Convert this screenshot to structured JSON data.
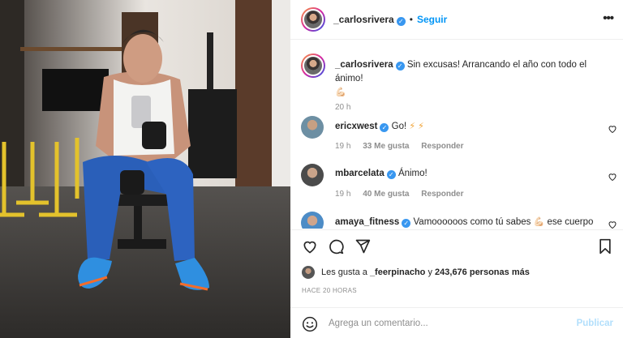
{
  "post": {
    "username": "_carlosrivera",
    "follow_label": "Seguir",
    "separator": "•"
  },
  "caption": {
    "username": "_carlosrivera",
    "text": "Sin excusas! Arrancando el año con todo el ánimo!",
    "emoji": "💪🏻",
    "time": "20 h"
  },
  "comments": [
    {
      "username": "ericxwest",
      "text": "Go!",
      "emoji": "⚡ ⚡",
      "time": "19 h",
      "likes": "33 Me gusta",
      "reply": "Responder"
    },
    {
      "username": "mbarcelata",
      "text": "Ánimo!",
      "emoji": "",
      "time": "19 h",
      "likes": "40 Me gusta",
      "reply": "Responder"
    },
    {
      "username": "amaya_fitness",
      "text": "Vamoooooos como tú sabes",
      "emoji": "💪🏻",
      "text2": "ese cuerpo"
    }
  ],
  "likes": {
    "prefix": "Les gusta a",
    "user": "_feerpinacho",
    "middle": "y",
    "count": "243,676 personas más"
  },
  "ago": "HACE 20 HORAS",
  "composer": {
    "placeholder": "Agrega un comentario...",
    "post_label": "Publicar"
  },
  "colors": {
    "accent": "#0095f6",
    "verified": "#3897f0",
    "muted": "#8e8e8e"
  }
}
